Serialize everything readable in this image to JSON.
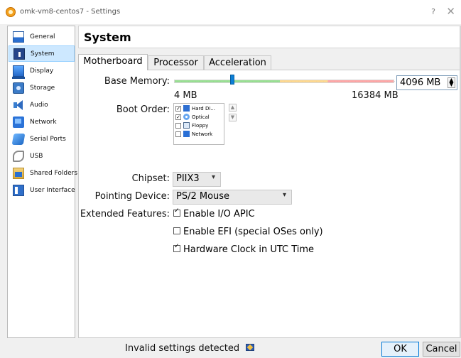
{
  "window": {
    "title": "omk-vm8-centos7 - Settings",
    "help_glyph": "?",
    "close_glyph": "✕"
  },
  "sidebar": {
    "items": [
      {
        "label": "General",
        "icon": "general-icon"
      },
      {
        "label": "System",
        "icon": "system-icon",
        "selected": true
      },
      {
        "label": "Display",
        "icon": "display-icon"
      },
      {
        "label": "Storage",
        "icon": "storage-icon"
      },
      {
        "label": "Audio",
        "icon": "audio-icon"
      },
      {
        "label": "Network",
        "icon": "network-icon"
      },
      {
        "label": "Serial Ports",
        "icon": "serial-ports-icon"
      },
      {
        "label": "USB",
        "icon": "usb-icon"
      },
      {
        "label": "Shared Folders",
        "icon": "shared-folders-icon"
      },
      {
        "label": "User Interface",
        "icon": "user-interface-icon"
      }
    ]
  },
  "main": {
    "title": "System",
    "tabs": [
      "Motherboard",
      "Processor",
      "Acceleration"
    ],
    "active_tab": "Motherboard",
    "base_memory": {
      "label": "Base Memory:",
      "min": "4 MB",
      "max": "16384 MB",
      "value": "4096 MB",
      "value_mb": 4096,
      "max_mb": 16384
    },
    "boot_order": {
      "label": "Boot Order:",
      "items": [
        {
          "label": "Hard Di...",
          "checked": true,
          "icon": "hard-disk-icon"
        },
        {
          "label": "Optical",
          "checked": true,
          "icon": "optical-icon"
        },
        {
          "label": "Floppy",
          "checked": false,
          "icon": "floppy-icon"
        },
        {
          "label": "Network",
          "checked": false,
          "icon": "network-icon"
        }
      ],
      "up_glyph": "▲",
      "down_glyph": "▼"
    },
    "chipset": {
      "label": "Chipset:",
      "value": "PIIX3"
    },
    "pointing_device": {
      "label": "Pointing Device:",
      "value": "PS/2 Mouse"
    },
    "extended_features": {
      "label": "Extended Features:",
      "options": [
        {
          "label": "Enable I/O APIC",
          "checked": true
        },
        {
          "label": "Enable EFI (special OSes only)",
          "checked": false
        },
        {
          "label": "Hardware Clock in UTC Time",
          "checked": true
        }
      ]
    }
  },
  "footer": {
    "warning": "Invalid settings detected",
    "ok": "OK",
    "cancel": "Cancel"
  },
  "colors": {
    "selection": "#cde8ff",
    "accent": "#0078d7",
    "slider_handle": "#0c7fd6"
  }
}
